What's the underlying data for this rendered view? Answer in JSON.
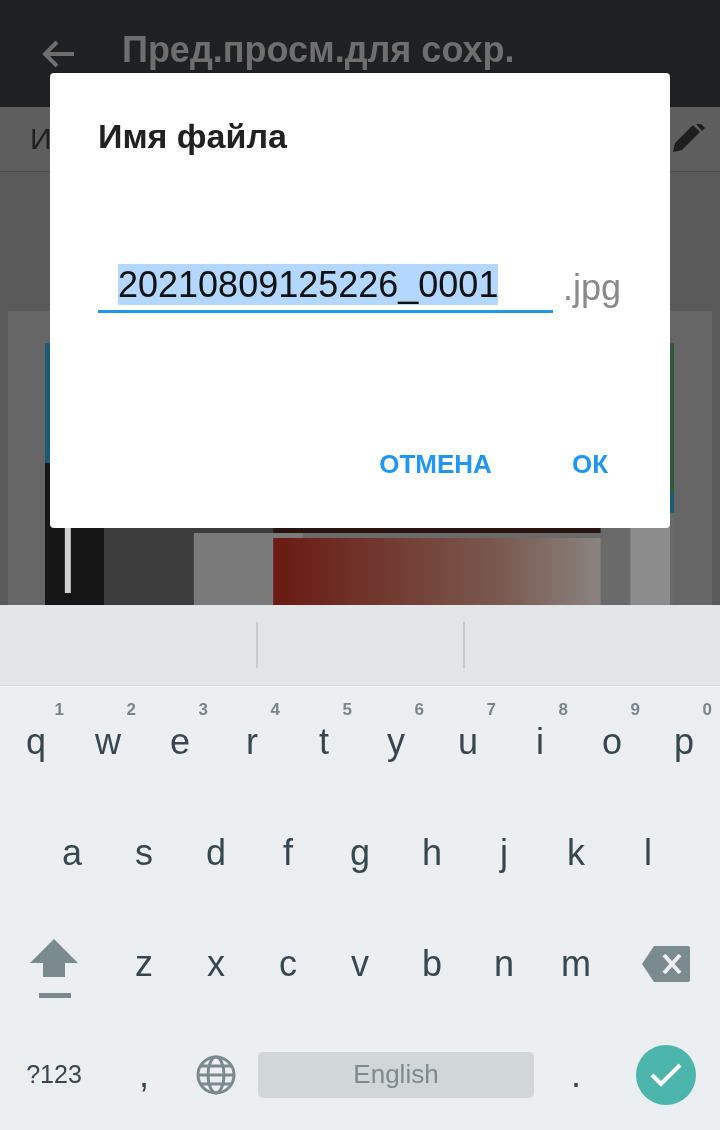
{
  "app_bar": {
    "title": "Пред.просм.для сохр."
  },
  "toolbar": {
    "label": "И"
  },
  "dialog": {
    "title": "Имя файла",
    "filename": {
      "value": "20210809125226_0001",
      "selected": true
    },
    "extension": ".jpg",
    "buttons": [
      {
        "label": "ОТМЕНА"
      },
      {
        "label": "ОК"
      }
    ]
  },
  "keyboard": {
    "rows": [
      {
        "keys": [
          {
            "kind": "letter",
            "label": "q",
            "hint": "1"
          },
          {
            "kind": "letter",
            "label": "w",
            "hint": "2"
          },
          {
            "kind": "letter",
            "label": "e",
            "hint": "3"
          },
          {
            "kind": "letter",
            "label": "r",
            "hint": "4"
          },
          {
            "kind": "letter",
            "label": "t",
            "hint": "5"
          },
          {
            "kind": "letter",
            "label": "y",
            "hint": "6"
          },
          {
            "kind": "letter",
            "label": "u",
            "hint": "7"
          },
          {
            "kind": "letter",
            "label": "i",
            "hint": "8"
          },
          {
            "kind": "letter",
            "label": "o",
            "hint": "9"
          },
          {
            "kind": "letter",
            "label": "p",
            "hint": "0"
          }
        ]
      },
      {
        "keys": [
          {
            "kind": "letter",
            "label": "a"
          },
          {
            "kind": "letter",
            "label": "s"
          },
          {
            "kind": "letter",
            "label": "d"
          },
          {
            "kind": "letter",
            "label": "f"
          },
          {
            "kind": "letter",
            "label": "g"
          },
          {
            "kind": "letter",
            "label": "h"
          },
          {
            "kind": "letter",
            "label": "j"
          },
          {
            "kind": "letter",
            "label": "k"
          },
          {
            "kind": "letter",
            "label": "l"
          }
        ]
      },
      {
        "keys": [
          {
            "kind": "shift"
          },
          {
            "kind": "letter",
            "label": "z"
          },
          {
            "kind": "letter",
            "label": "x"
          },
          {
            "kind": "letter",
            "label": "c"
          },
          {
            "kind": "letter",
            "label": "v"
          },
          {
            "kind": "letter",
            "label": "b"
          },
          {
            "kind": "letter",
            "label": "n"
          },
          {
            "kind": "letter",
            "label": "m"
          },
          {
            "kind": "backspace"
          }
        ]
      },
      {
        "keys": [
          {
            "kind": "symbols",
            "label": "?123"
          },
          {
            "kind": "letter",
            "label": ","
          },
          {
            "kind": "globe"
          },
          {
            "kind": "space",
            "label": "English"
          },
          {
            "kind": "letter",
            "label": "."
          },
          {
            "kind": "enter"
          }
        ]
      }
    ]
  }
}
